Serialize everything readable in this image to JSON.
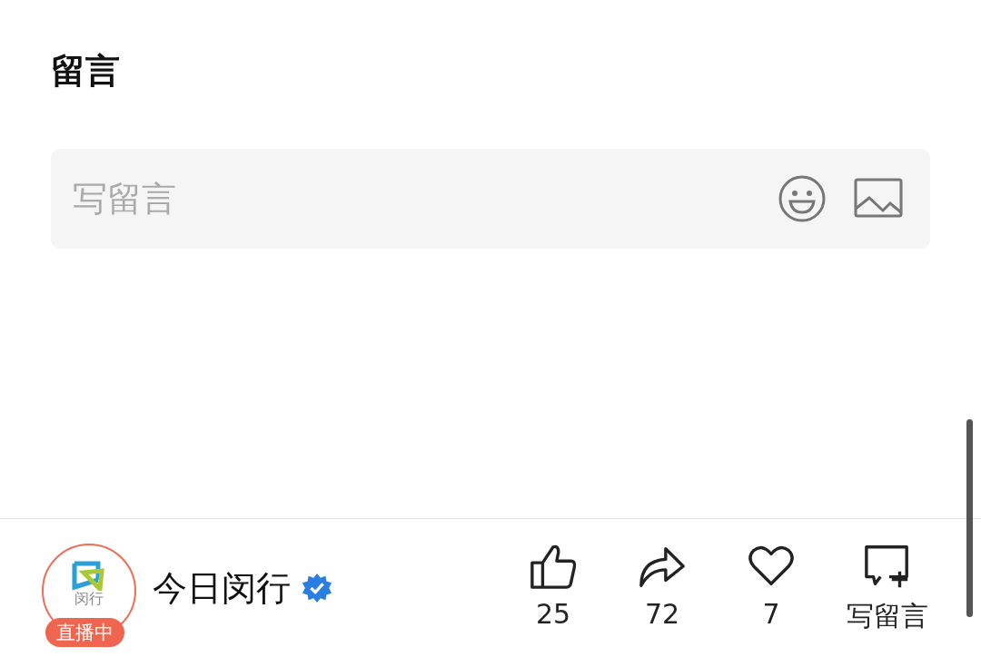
{
  "section_title": "留言",
  "comment_field": {
    "placeholder": "写留言"
  },
  "account": {
    "logo_text": "闵行",
    "live_badge": "直播中",
    "name": "今日闵行",
    "verified": true
  },
  "actions": [
    {
      "kind": "like",
      "label": "25"
    },
    {
      "kind": "share",
      "label": "72"
    },
    {
      "kind": "favorite",
      "label": "7"
    },
    {
      "kind": "comment",
      "label": "写留言"
    }
  ]
}
